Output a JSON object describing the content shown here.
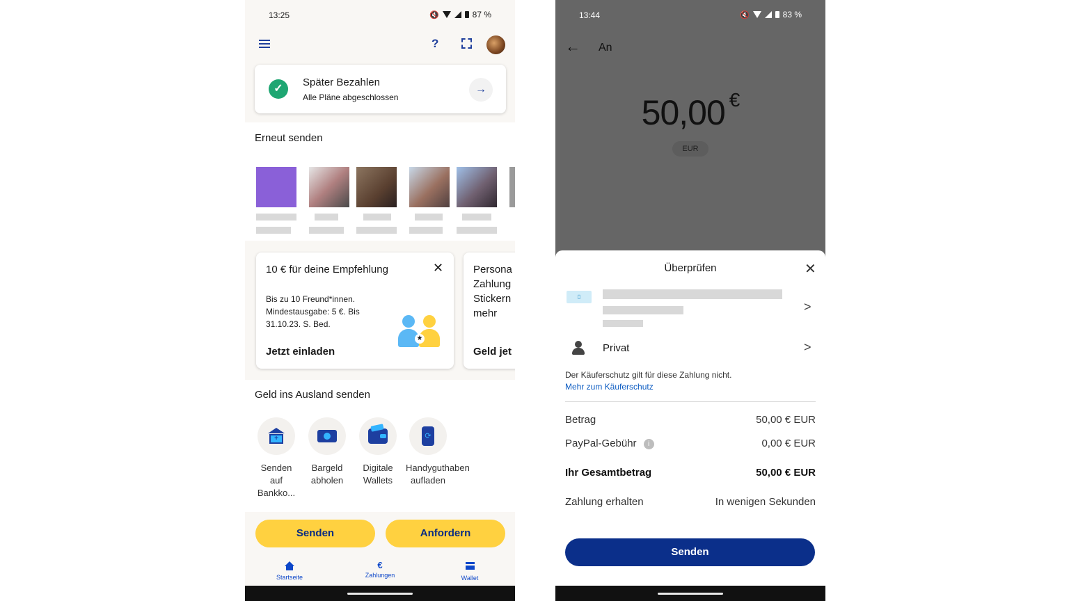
{
  "left_screen": {
    "status": {
      "time": "13:25",
      "battery": "87 %"
    },
    "header": {
      "help_glyph": "?"
    },
    "pay_later": {
      "title": "Später Bezahlen",
      "subtitle": "Alle Pläne abgeschlossen"
    },
    "resend": {
      "title": "Erneut senden"
    },
    "promo_referral": {
      "title": "10 € für deine Empfehlung",
      "body": "Bis zu 10 Freund*innen. Mindestausgabe: 5 €. Bis 31.10.23. S. Bed.",
      "cta": "Jetzt einladen"
    },
    "promo_second": {
      "title": "Persona Zahlung Stickern mehr",
      "cta": "Geld jet"
    },
    "abroad": {
      "title": "Geld ins Ausland senden",
      "items": [
        {
          "label": "Senden auf Bankko...",
          "icon": "bank-icon"
        },
        {
          "label": "Bargeld abholen",
          "icon": "cash-icon"
        },
        {
          "label": "Digitale Wallets",
          "icon": "wallet-icon"
        },
        {
          "label": "Handyguthaben aufladen",
          "icon": "phone-topup-icon"
        }
      ]
    },
    "actions": {
      "send": "Senden",
      "request": "Anfordern"
    },
    "nav": {
      "home": "Startseite",
      "payments": "Zahlungen",
      "payments_glyph": "€",
      "wallet": "Wallet"
    }
  },
  "right_screen": {
    "status": {
      "time": "13:44",
      "battery": "83 %"
    },
    "header": {
      "to_label": "An"
    },
    "amount": {
      "value": "50,00",
      "symbol": "€",
      "currency": "EUR"
    },
    "sheet": {
      "title": "Überprüfen",
      "privacy_label": "Privat",
      "notice": "Der Käuferschutz gilt für diese Zahlung nicht.",
      "notice_link": "Mehr zum Käuferschutz",
      "rows": [
        {
          "key": "Betrag",
          "value": "50,00 € EUR"
        },
        {
          "key": "PayPal-Gebühr",
          "value": "0,00 € EUR"
        },
        {
          "key": "Ihr Gesamtbetrag",
          "value": "50,00 € EUR"
        },
        {
          "key": "Zahlung erhalten",
          "value": "In wenigen Sekunden"
        }
      ],
      "send_button": "Senden"
    }
  },
  "colors": {
    "paypal_yellow": "#ffd140",
    "paypal_navy": "#0b2f8a",
    "accent_blue": "#0d47c9",
    "success_green": "#1ea672"
  }
}
